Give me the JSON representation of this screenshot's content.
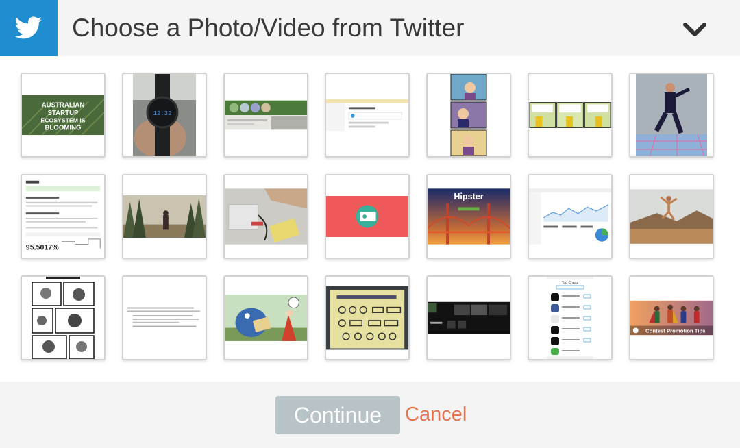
{
  "header": {
    "title": "Choose a Photo/Video from Twitter",
    "icon": "twitter-bird-icon",
    "toggle_icon": "chevron-down-icon",
    "brand_color": "#1f8ed0"
  },
  "thumbnails": [
    {
      "name": "thumb-australian-startup",
      "text": "AUSTRALIAN STARTUP ECOSYSTEM IS BLOOMING"
    },
    {
      "name": "thumb-smartwatch",
      "text": ""
    },
    {
      "name": "thumb-website-banner",
      "text": ""
    },
    {
      "name": "thumb-dashboard-screenshot",
      "text": ""
    },
    {
      "name": "thumb-comic-vertical",
      "text": ""
    },
    {
      "name": "thumb-comic-strip",
      "text": ""
    },
    {
      "name": "thumb-jumping-man",
      "text": ""
    },
    {
      "name": "thumb-github-stats",
      "text": "95.5017%"
    },
    {
      "name": "thumb-forest-hiker",
      "text": ""
    },
    {
      "name": "thumb-laptop-usb",
      "text": ""
    },
    {
      "name": "thumb-red-app-card",
      "text": ""
    },
    {
      "name": "thumb-hipster-bridge",
      "text": "Hipster"
    },
    {
      "name": "thumb-analytics",
      "text": ""
    },
    {
      "name": "thumb-desert-jump",
      "text": ""
    },
    {
      "name": "thumb-manga-page",
      "text": ""
    },
    {
      "name": "thumb-text-document",
      "text": ""
    },
    {
      "name": "thumb-illustration",
      "text": ""
    },
    {
      "name": "thumb-whiteboard-photo",
      "text": ""
    },
    {
      "name": "thumb-dark-webpage",
      "text": ""
    },
    {
      "name": "thumb-app-store-list",
      "text": "Top Charts"
    },
    {
      "name": "thumb-contest-heroes",
      "text": "Contest Promotion Tips"
    }
  ],
  "footer": {
    "continue_label": "Continue",
    "cancel_label": "Cancel",
    "cancel_color": "#e8734f"
  }
}
